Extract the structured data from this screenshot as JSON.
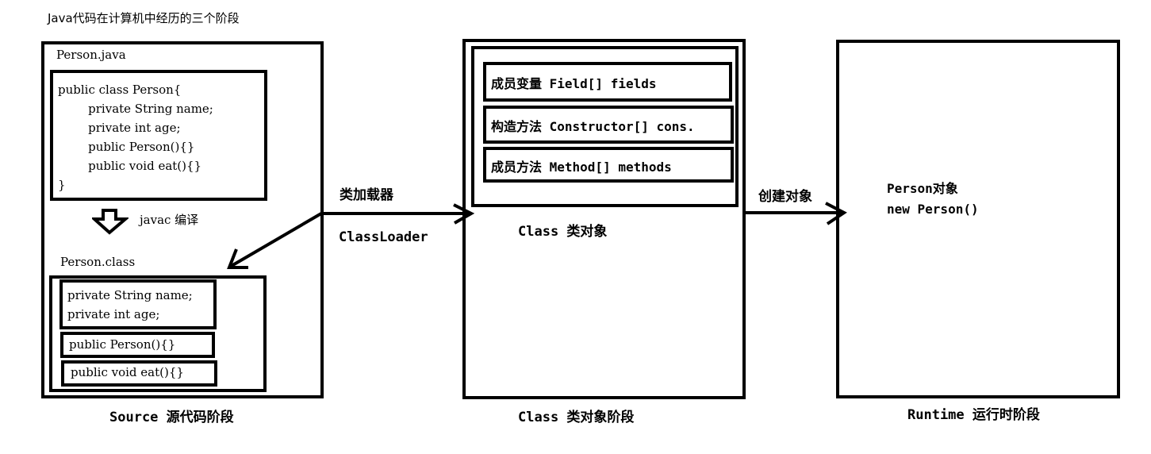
{
  "title": "Java代码在计算机中经历的三个阶段",
  "source": {
    "file_label": "Person.java",
    "java_code": [
      "public class Person{",
      "        private String name;",
      "        private int age;",
      "        public Person(){}",
      "        public void eat(){}",
      "}"
    ],
    "compile_label": "javac 编译",
    "class_label": "Person.class",
    "class_sections": [
      [
        "private String name;",
        "private int age;"
      ],
      [
        "public Person(){}"
      ],
      [
        "public void eat(){}"
      ]
    ],
    "stage_label": "Source 源代码阶段"
  },
  "loader": {
    "label_cn": "类加载器",
    "label_en": "ClassLoader"
  },
  "class_object": {
    "members": [
      "成员变量 Field[] fields",
      "构造方法 Constructor[] cons.",
      "成员方法 Method[] methods"
    ],
    "caption": "Class 类对象",
    "stage_label": "Class 类对象阶段"
  },
  "create": {
    "label": "创建对象"
  },
  "runtime": {
    "lines": [
      "Person对象",
      "new Person()"
    ],
    "stage_label": "Runtime 运行时阶段"
  }
}
